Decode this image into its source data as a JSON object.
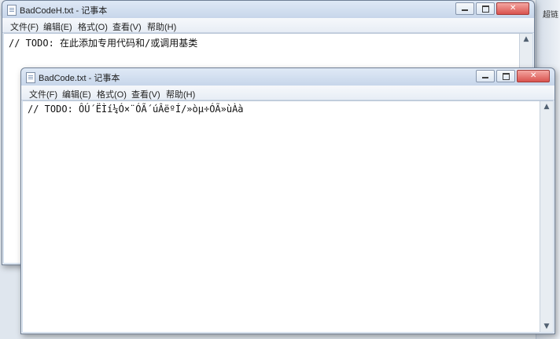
{
  "background": {
    "right_panel_label": "超链"
  },
  "back_window": {
    "title": "BadCodeH.txt - 记事本",
    "menu": [
      "文件(F)",
      "编辑(E)",
      "格式(O)",
      "查看(V)",
      "帮助(H)"
    ],
    "content": "// TODO: 在此添加专用代码和/或调用基类"
  },
  "front_window": {
    "title": "BadCode.txt - 记事本",
    "menu": [
      "文件(F)",
      "编辑(E)",
      "格式(O)",
      "查看(V)",
      "帮助(H)"
    ],
    "content": "// TODO: ÔÚ´ËÌí¼Ó×¨ÓÃ´úÂëºÍ/»òµ÷ÓÃ»ùÀà"
  },
  "colors": {
    "titlebar": "#cfdceb",
    "close_button": "#d9534f",
    "editor_bg": "#ffffff"
  },
  "icons": {
    "title_icon": "notepad-icon",
    "minimize": "minimize-icon",
    "maximize": "maximize-icon",
    "close": "close-icon",
    "scroll_up": "scroll-up-arrow-icon",
    "scroll_down": "scroll-down-arrow-icon"
  }
}
